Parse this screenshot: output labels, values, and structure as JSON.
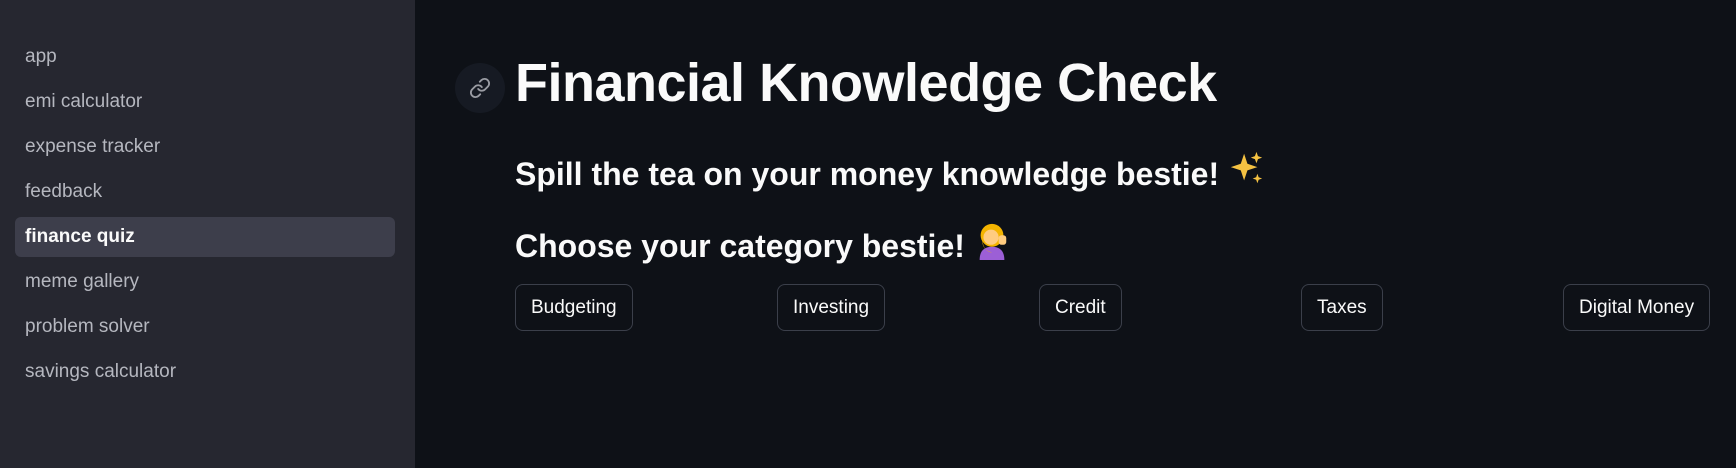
{
  "sidebar": {
    "items": [
      {
        "label": "app",
        "active": false
      },
      {
        "label": "emi calculator",
        "active": false
      },
      {
        "label": "expense tracker",
        "active": false
      },
      {
        "label": "feedback",
        "active": false
      },
      {
        "label": "finance quiz",
        "active": true
      },
      {
        "label": "meme gallery",
        "active": false
      },
      {
        "label": "problem solver",
        "active": false
      },
      {
        "label": "savings calculator",
        "active": false
      }
    ]
  },
  "main": {
    "anchor_icon": "link-icon",
    "title": "Financial Knowledge Check",
    "subtitle": "Spill the tea on your money knowledge bestie!",
    "subtitle_emoji_icon": "sparkles-icon",
    "category_heading": "Choose your category bestie!",
    "category_heading_emoji_icon": "tipping-hand-woman-icon",
    "categories": [
      "Budgeting",
      "Investing",
      "Credit",
      "Taxes",
      "Digital Money"
    ]
  },
  "colors": {
    "background": "#0e1117",
    "sidebar": "#262730",
    "sidebar_active": "#3d3e4b",
    "text": "#fafafa",
    "text_muted": "#b5b7bf",
    "button_border": "#3b3f4a",
    "sparkle": "#f5c242",
    "hair": "#f4b400",
    "shirt": "#9c5fd6"
  }
}
